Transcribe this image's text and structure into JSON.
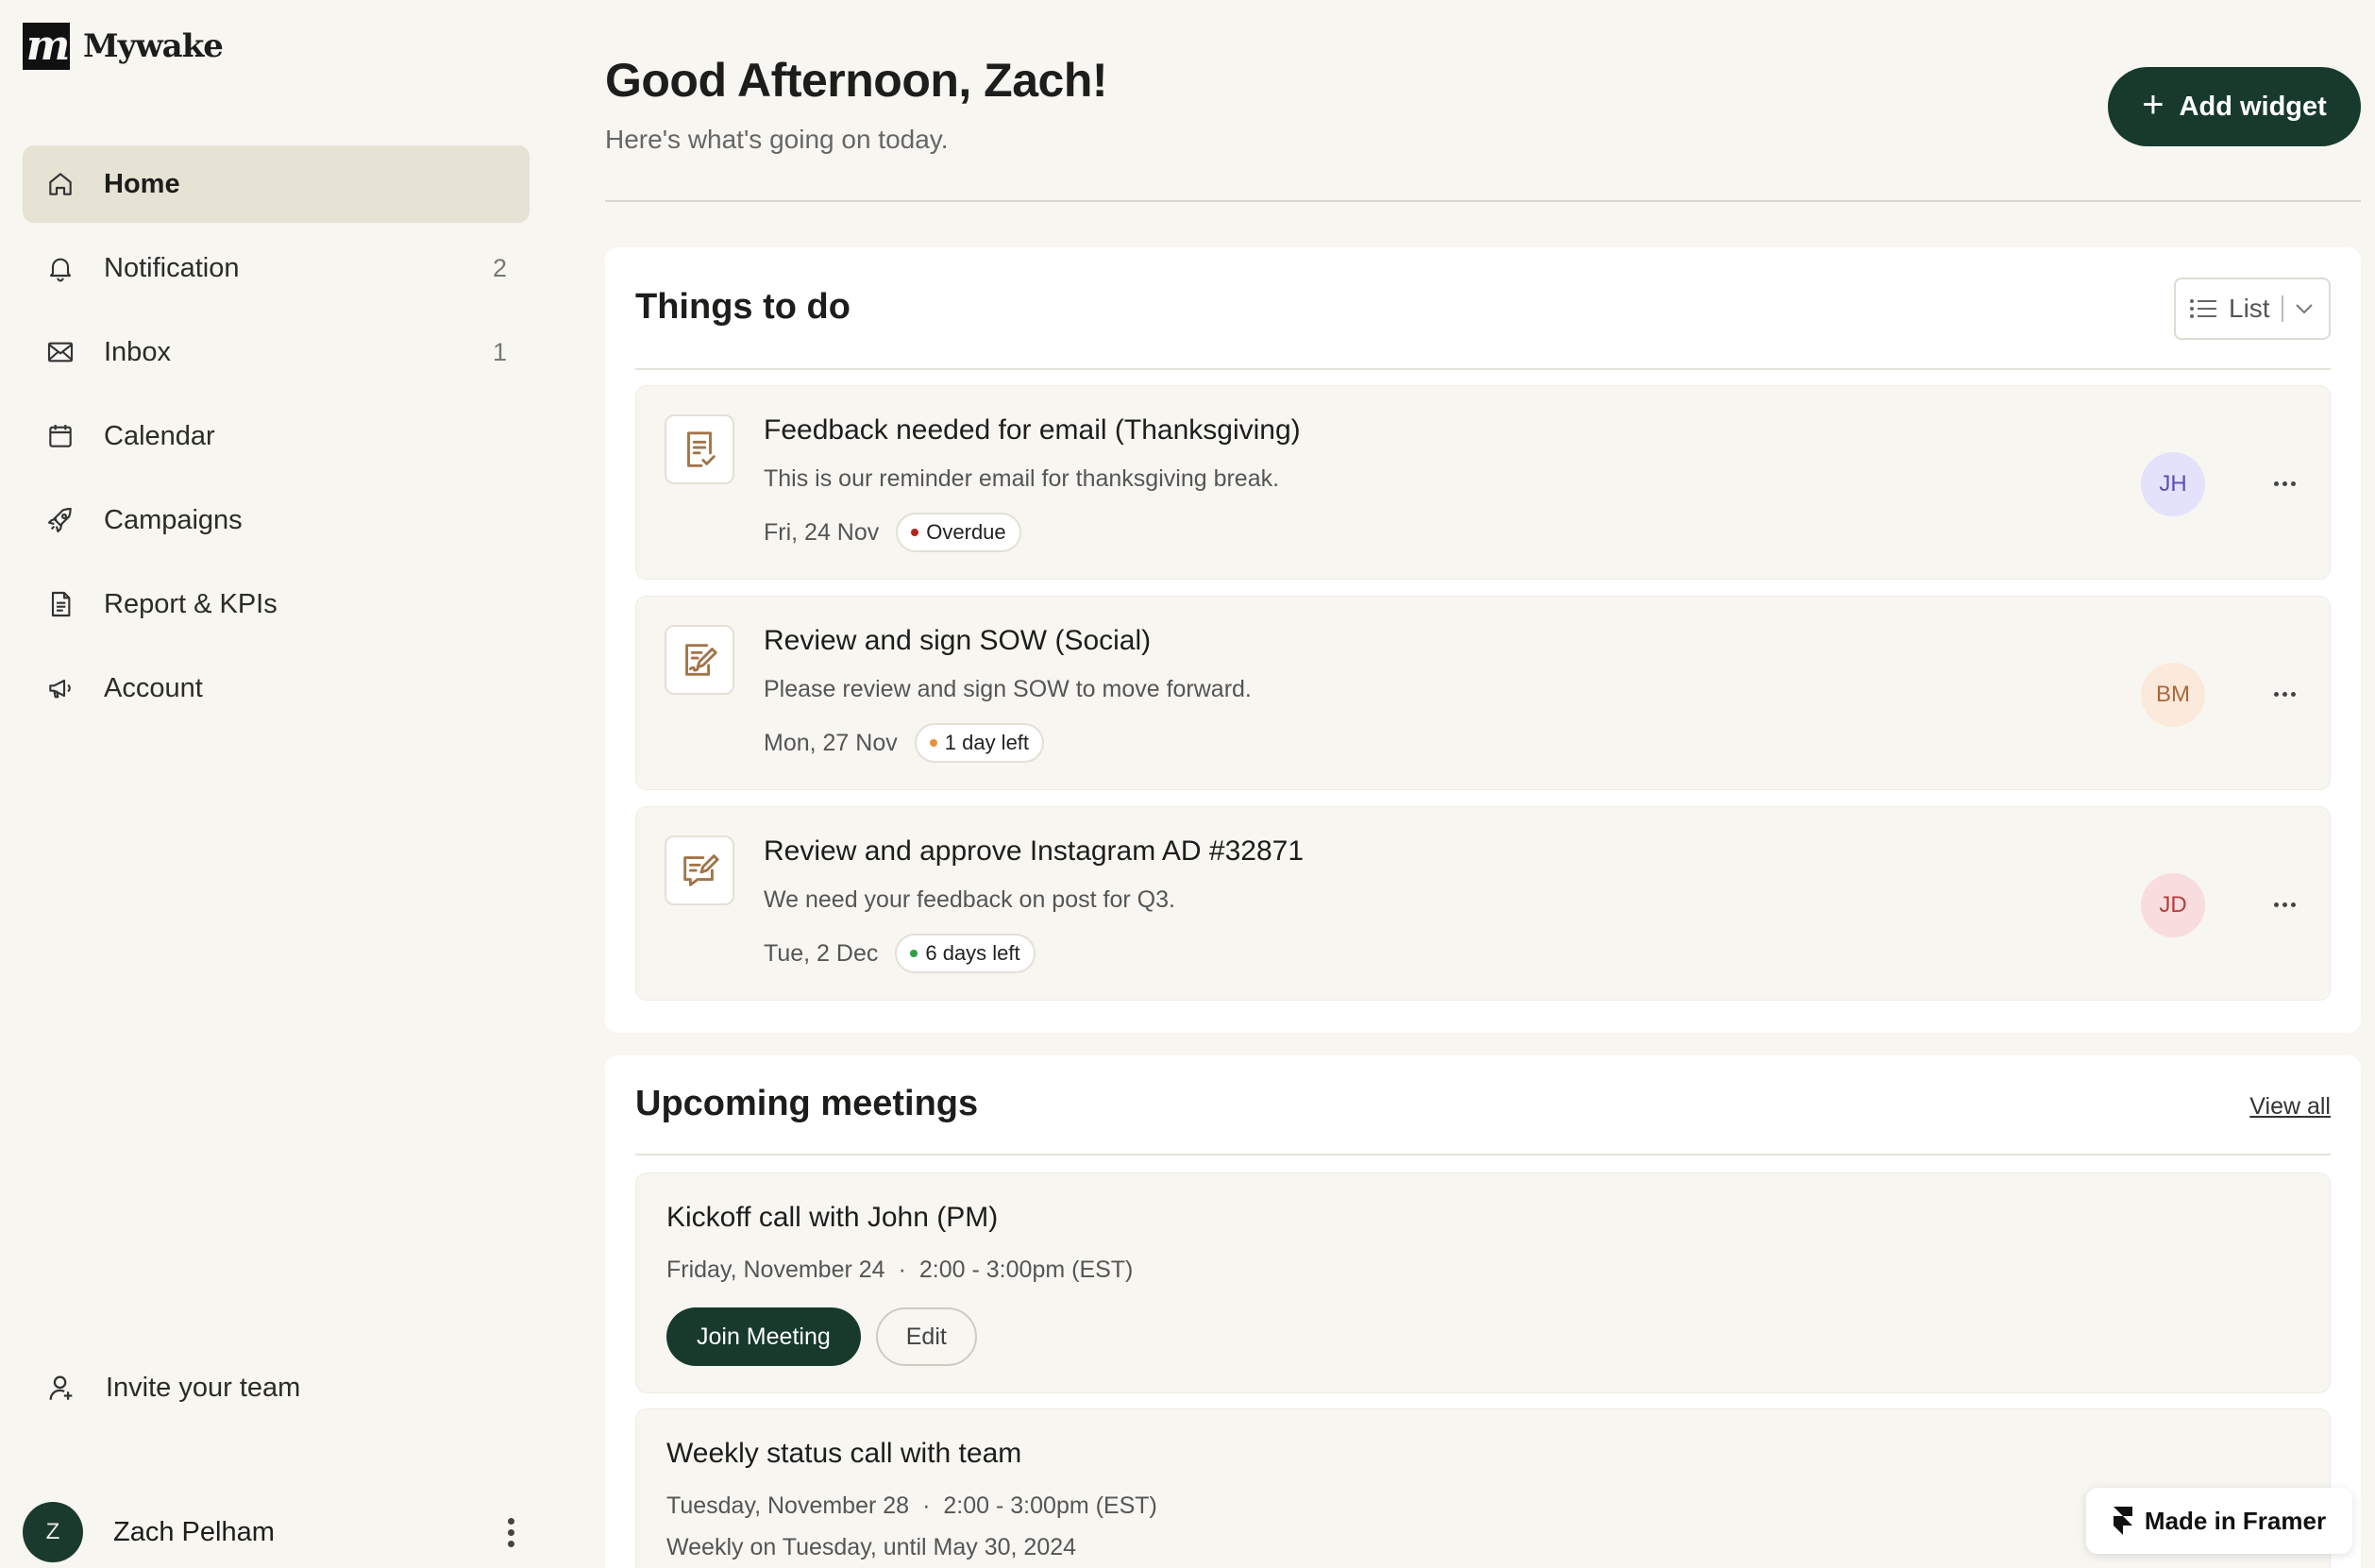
{
  "brand": {
    "name": "Mywake",
    "mark": "m"
  },
  "sidebar": {
    "items": [
      {
        "label": "Home",
        "count": ""
      },
      {
        "label": "Notification",
        "count": "2"
      },
      {
        "label": "Inbox",
        "count": "1"
      },
      {
        "label": "Calendar",
        "count": ""
      },
      {
        "label": "Campaigns",
        "count": ""
      },
      {
        "label": "Report & KPIs",
        "count": ""
      },
      {
        "label": "Account",
        "count": ""
      }
    ],
    "invite_label": "Invite your team",
    "user": {
      "initial": "Z",
      "name": "Zach Pelham"
    }
  },
  "header": {
    "greeting": "Good Afternoon, Zach!",
    "subtitle": "Here's what's going on today.",
    "add_widget_label": "Add widget"
  },
  "todo": {
    "title": "Things to do",
    "view_selector": "List",
    "tasks": [
      {
        "title": "Feedback needed for email (Thanksgiving)",
        "description": "This is our reminder email for thanksgiving break.",
        "date": "Fri, 24 Nov",
        "status": "Overdue",
        "status_color": "#b3261e",
        "assignee": "JH",
        "avatar_bg": "#e4e1fb",
        "avatar_fg": "#5b4fb3",
        "icon": "checklist-icon"
      },
      {
        "title": "Review and sign SOW (Social)",
        "description": "Please review and sign SOW to move forward.",
        "date": "Mon, 27 Nov",
        "status": "1 day left",
        "status_color": "#e8923a",
        "assignee": "BM",
        "avatar_bg": "#fbeadb",
        "avatar_fg": "#a8683a",
        "icon": "sign-document-icon"
      },
      {
        "title": "Review and approve Instagram AD #32871",
        "description": "We need your feedback on post for Q3.",
        "date": "Tue, 2 Dec",
        "status": "6 days left",
        "status_color": "#2f9e44",
        "assignee": "JD",
        "avatar_bg": "#f9dcdd",
        "avatar_fg": "#b3403f",
        "icon": "approve-message-icon"
      }
    ]
  },
  "meetings": {
    "title": "Upcoming meetings",
    "view_all_label": "View all",
    "items": [
      {
        "title": "Kickoff call with John (PM)",
        "day": "Friday, November 24",
        "time": "2:00 - 3:00pm (EST)",
        "join_label": "Join Meeting",
        "edit_label": "Edit"
      },
      {
        "title": "Weekly status call with team",
        "day": "Tuesday, November 28",
        "time": "2:00 - 3:00pm (EST)",
        "recurrence": "Weekly on Tuesday, until May 30, 2024"
      }
    ]
  },
  "framer_badge": "Made in Framer",
  "colors": {
    "accent_dark_green": "#173a2d",
    "background": "#f7f6f1",
    "active_nav": "#e6e2d4",
    "icon_brown": "#a27448"
  }
}
